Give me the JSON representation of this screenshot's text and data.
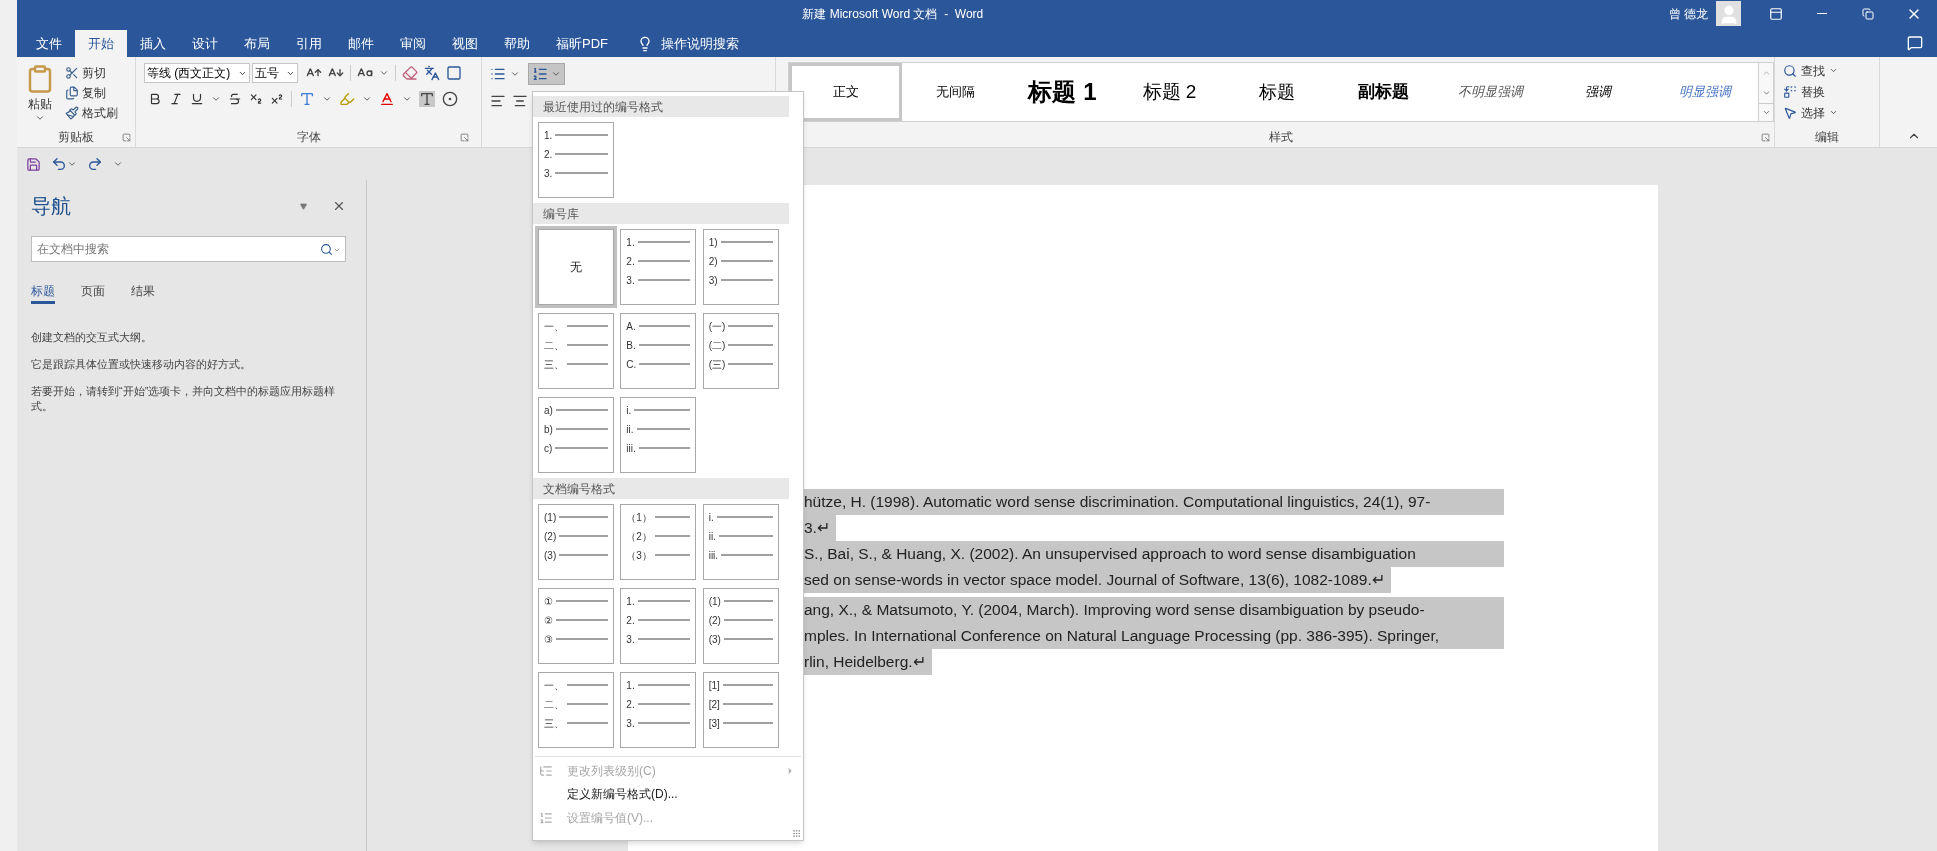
{
  "window": {
    "title": "新建 Microsoft Word 文档  -  Word",
    "user": "曾 德龙"
  },
  "tabs": [
    {
      "label": "文件",
      "selected": false
    },
    {
      "label": "开始",
      "selected": true
    },
    {
      "label": "插入",
      "selected": false
    },
    {
      "label": "设计",
      "selected": false
    },
    {
      "label": "布局",
      "selected": false
    },
    {
      "label": "引用",
      "selected": false
    },
    {
      "label": "邮件",
      "selected": false
    },
    {
      "label": "审阅",
      "selected": false
    },
    {
      "label": "视图",
      "selected": false
    },
    {
      "label": "帮助",
      "selected": false
    },
    {
      "label": "福昕PDF",
      "selected": false
    }
  ],
  "tell_me": "操作说明搜索",
  "ribbon": {
    "clipboard": {
      "label": "剪贴板",
      "paste": "粘贴",
      "items": [
        {
          "label": "剪切",
          "kind": "cut"
        },
        {
          "label": "复制",
          "kind": "copy"
        },
        {
          "label": "格式刷",
          "kind": "format-painter"
        }
      ]
    },
    "font": {
      "label": "字体",
      "font_name": "等线 (西文正文)",
      "font_size": "五号"
    },
    "paragraph": {
      "numbering_pressed": true
    },
    "styles": {
      "label": "样式",
      "items": [
        {
          "label": "正文",
          "kind": "normal",
          "selected": true
        },
        {
          "label": "无间隔",
          "kind": "no-spacing",
          "selected": false
        },
        {
          "label": "标题 1",
          "kind": "heading1",
          "selected": false
        },
        {
          "label": "标题 2",
          "kind": "heading2",
          "selected": false
        },
        {
          "label": "标题",
          "kind": "title",
          "selected": false
        },
        {
          "label": "副标题",
          "kind": "subtitle",
          "selected": false
        },
        {
          "label": "不明显强调",
          "kind": "subtle-emphasis",
          "selected": false
        },
        {
          "label": "强调",
          "kind": "emphasis",
          "selected": false
        },
        {
          "label": "明显强调",
          "kind": "intense-emphasis",
          "selected": false
        }
      ]
    },
    "editing": {
      "label": "编辑",
      "items": [
        {
          "label": "查找",
          "kind": "find"
        },
        {
          "label": "替换",
          "kind": "replace"
        },
        {
          "label": "选择",
          "kind": "select"
        }
      ]
    }
  },
  "navigation": {
    "title": "导航",
    "search": {
      "placeholder": "在文档中搜索"
    },
    "tabs": [
      {
        "label": "标题",
        "selected": true
      },
      {
        "label": "页面",
        "selected": false
      },
      {
        "label": "结果",
        "selected": false
      }
    ],
    "paragraphs": [
      "创建文档的交互式大纲。",
      "它是跟踪具体位置或快速移动内容的好方式。",
      "若要开始，请转到“开始”选项卡，并向文档中的标题应用标题样式。"
    ]
  },
  "document": {
    "lines": [
      {
        "text": "hütze, H. (1998). Automatic word sense discrimination. Computational linguistics, 24(1), 97-",
        "full": true
      },
      {
        "text": "3.↵",
        "full": false
      },
      {
        "text": "S., Bai, S., & Huang, X. (2002). An unsupervised approach to word sense disambiguation",
        "full": true
      },
      {
        "text": "sed on sense-words in vector space model. Journal of Software, 13(6), 1082-1089.↵",
        "full": false
      },
      {
        "text": "ang, X., & Matsumoto, Y. (2004, March). Improving word sense disambiguation by pseudo-",
        "full": true
      },
      {
        "text": "mples. In International Conference on Natural Language Processing (pp. 386-395). Springer,",
        "full": true
      },
      {
        "text": "rlin, Heidelberg.↵",
        "full": false
      }
    ]
  },
  "numbering_menu": {
    "sections": [
      {
        "title": "最近使用过的编号格式",
        "tiles": [
          {
            "kind": "list",
            "labels": [
              "1.",
              "2.",
              "3."
            ],
            "selected": false
          }
        ]
      },
      {
        "title": "编号库",
        "tiles": [
          {
            "kind": "none",
            "label": "无",
            "selected": true
          },
          {
            "kind": "list",
            "labels": [
              "1.",
              "2.",
              "3."
            ],
            "selected": false
          },
          {
            "kind": "list",
            "labels": [
              "1)",
              "2)",
              "3)"
            ],
            "selected": false
          },
          {
            "kind": "list",
            "labels": [
              "一、",
              "二、",
              "三、"
            ],
            "selected": false
          },
          {
            "kind": "list",
            "labels": [
              "A.",
              "B.",
              "C."
            ],
            "selected": false
          },
          {
            "kind": "list",
            "labels": [
              "(一)",
              "(二)",
              "(三)"
            ],
            "selected": false
          },
          {
            "kind": "list",
            "labels": [
              "a)",
              "b)",
              "c)"
            ],
            "selected": false
          },
          {
            "kind": "list",
            "labels": [
              "i.",
              "ii.",
              "iii."
            ],
            "selected": false
          }
        ]
      },
      {
        "title": "文档编号格式",
        "tiles": [
          {
            "kind": "list",
            "labels": [
              "(1)",
              "(2)",
              "(3)"
            ],
            "selected": false
          },
          {
            "kind": "list",
            "labels": [
              "（1）",
              "（2）",
              "（3）"
            ],
            "selected": false
          },
          {
            "kind": "list",
            "labels": [
              "i.",
              "ii.",
              "iii."
            ],
            "selected": false
          },
          {
            "kind": "list",
            "labels": [
              "①",
              "②",
              "③"
            ],
            "selected": false
          },
          {
            "kind": "list",
            "labels": [
              "1.",
              "2.",
              "3."
            ],
            "selected": false
          },
          {
            "kind": "list",
            "labels": [
              "(1)",
              "(2)",
              "(3)"
            ],
            "selected": false
          },
          {
            "kind": "list",
            "labels": [
              "一、",
              "二、",
              "三、"
            ],
            "selected": false
          },
          {
            "kind": "list",
            "labels": [
              "1.",
              "2.",
              "3."
            ],
            "selected": false
          },
          {
            "kind": "list",
            "labels": [
              "[1]",
              "[2]",
              "[3]"
            ],
            "selected": false
          }
        ]
      }
    ],
    "commands": [
      {
        "label": "更改列表级别(C)",
        "kind": "change-level",
        "disabled": true
      },
      {
        "label": "定义新编号格式(D)...",
        "kind": "define",
        "disabled": false
      },
      {
        "label": "设置编号值(V)...",
        "kind": "set-value",
        "disabled": true
      }
    ]
  }
}
